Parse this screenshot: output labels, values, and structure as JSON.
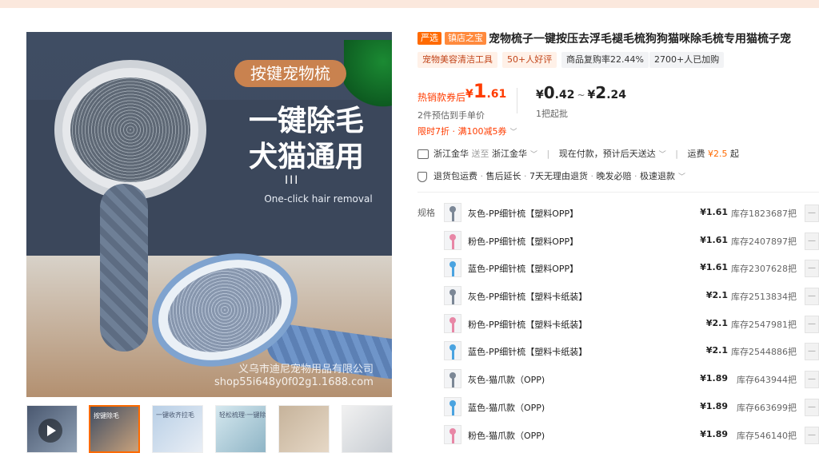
{
  "product": {
    "main_image": {
      "badge": "按键宠物梳",
      "headline_1": "一键除毛",
      "headline_2": "犬猫通用",
      "bars": "III",
      "subtitle": "One-click hair removal",
      "watermark_1": "义乌市迪尼宠物用品有限公司",
      "watermark_2": "shop55i648y0f02g1.1688.com"
    },
    "thumbnails": [
      {
        "label": "",
        "video": true
      },
      {
        "label": "按键除毛",
        "video": false
      },
      {
        "label": "一键收齐拉毛",
        "video": false
      },
      {
        "label": "轻松梳理·一键除毛",
        "video": false
      },
      {
        "label": "",
        "video": false
      },
      {
        "label": "",
        "video": false
      }
    ],
    "tags": [
      "严选",
      "镇店之宝"
    ],
    "title": "宠物梳子一键按压去浮毛褪毛梳狗狗猫咪除毛梳专用猫梳子宠",
    "chips": [
      "宠物美容清洁工具",
      "50+人好评",
      "商品复购率22.44%",
      "2700+人已加购"
    ],
    "hot_label": "热销款券后",
    "hot_price": {
      "currency": "¥",
      "int": "1",
      "dec": ".61"
    },
    "est_text": "2件预估到手单价",
    "price_range": {
      "currency": "¥",
      "low_int": "0",
      "low_dec": ".42",
      "tilde": "~",
      "high_int": "2",
      "high_dec": ".24"
    },
    "moq": "1把起批",
    "promo": "限时7折 · 满100减5券",
    "shipping": {
      "from": "浙江金华",
      "to_word": "送至",
      "to": "浙江金华",
      "payment": "现在付款，预计后天送达",
      "fee_label": "运费",
      "fee": "¥2.5",
      "fee_suffix": "起"
    },
    "services": [
      "退货包运费",
      "售后延长",
      "7天无理由退货",
      "晚发必赔",
      "极速退款"
    ],
    "spec_label": "规格",
    "skus": [
      {
        "name": "灰色-PP细针梳【塑料OPP】",
        "price": "¥1.61",
        "stock": "库存1823687把",
        "color": "#7b8796"
      },
      {
        "name": "粉色-PP细针梳【塑料OPP】",
        "price": "¥1.61",
        "stock": "库存2407897把",
        "color": "#e887a6"
      },
      {
        "name": "蓝色-PP细针梳【塑料OPP】",
        "price": "¥1.61",
        "stock": "库存2307628把",
        "color": "#4aa3e0"
      },
      {
        "name": "灰色-PP细针梳【塑料卡纸装】",
        "price": "¥2.1",
        "stock": "库存2513834把",
        "color": "#7b8796"
      },
      {
        "name": "粉色-PP细针梳【塑料卡纸装】",
        "price": "¥2.1",
        "stock": "库存2547981把",
        "color": "#e887a6"
      },
      {
        "name": "蓝色-PP细针梳【塑料卡纸装】",
        "price": "¥2.1",
        "stock": "库存2544886把",
        "color": "#4aa3e0"
      },
      {
        "name": "灰色-猫爪款（OPP)",
        "price": "¥1.89",
        "stock": "库存643944把",
        "color": "#7b8796"
      },
      {
        "name": "蓝色-猫爪款（OPP)",
        "price": "¥1.89",
        "stock": "库存663699把",
        "color": "#4aa3e0"
      },
      {
        "name": "粉色-猫爪款（OPP)",
        "price": "¥1.89",
        "stock": "库存546140把",
        "color": "#e887a6"
      }
    ],
    "stepper_label": "—"
  }
}
